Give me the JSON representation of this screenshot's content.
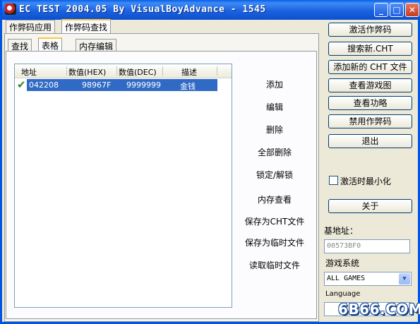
{
  "window": {
    "title": "EC TEST 2004.05  By VisualBoyAdvance - 1545",
    "buttons": {
      "minimize": "_",
      "maximize": "□",
      "close": "✕"
    }
  },
  "outer_tabs": [
    "作弊码应用",
    "作弊码查找"
  ],
  "inner_tabs": [
    "查找",
    "表格",
    "内存编辑"
  ],
  "table": {
    "columns": [
      "地址",
      "数值(HEX)",
      "数值(DEC)",
      "描述"
    ],
    "rows": [
      {
        "checked": true,
        "address": "042208",
        "hex": "98967F",
        "dec": "9999999",
        "desc": "金钱"
      }
    ]
  },
  "commands": [
    "添加",
    "编辑",
    "删除",
    "全部删除",
    "锁定/解锁",
    "内存查看",
    "保存为CHT文件",
    "保存为临时文件",
    "读取临时文件"
  ],
  "right_buttons": [
    "激活作弊码",
    "搜索新.CHT",
    "添加新的 CHT 文件",
    "查看游戏图",
    "查看功略",
    "禁用作弊码",
    "退出"
  ],
  "minimize_on_activate": {
    "label": "激活时最小化",
    "checked": false
  },
  "about_button": "关于",
  "base_address": {
    "label": "基地址：",
    "value": "00573BF0"
  },
  "game_system": {
    "label": "游戏系统",
    "selected": "ALL GAMES"
  },
  "language": {
    "label": "Language"
  },
  "watermark": "6B66.COM",
  "colors": {
    "title_bar": "#0a5fe8",
    "selection": "#316ac5",
    "check": "#2d8a1f",
    "tab_highlight": "#ffc73c"
  }
}
